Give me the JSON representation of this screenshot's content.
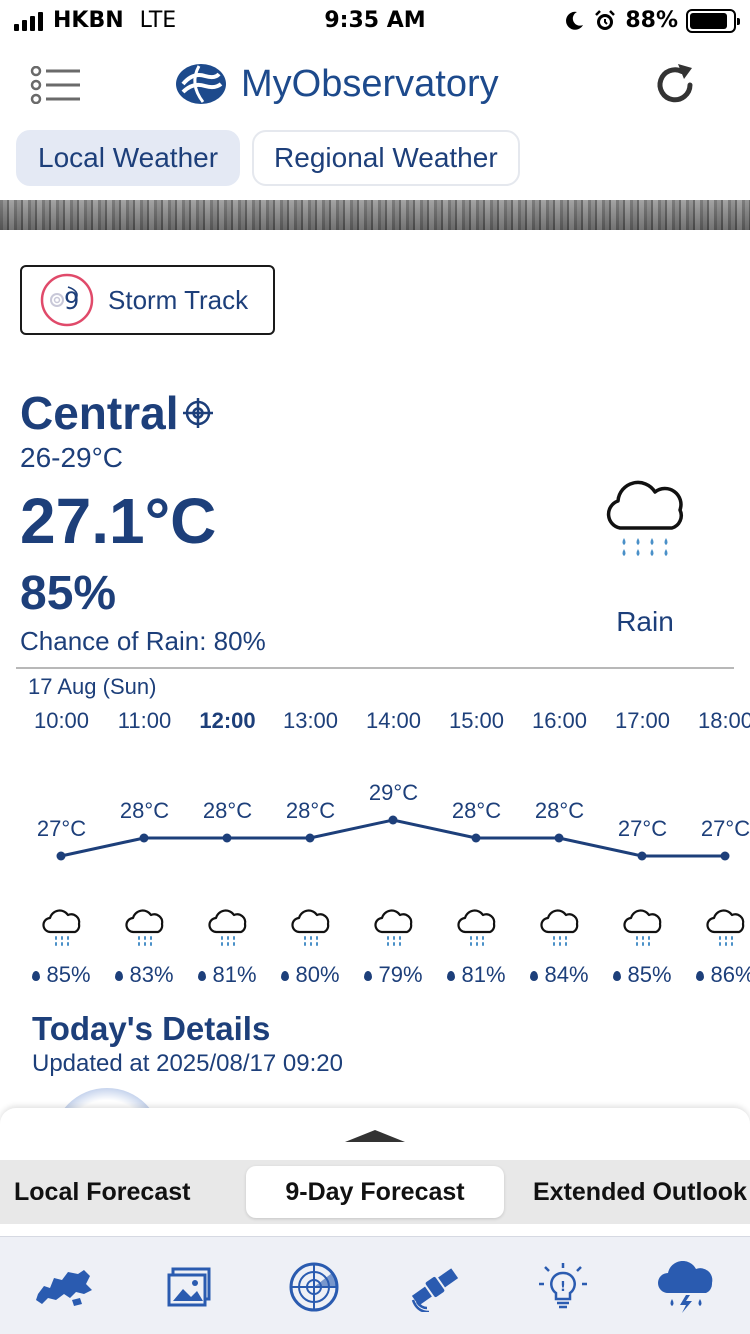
{
  "status_bar": {
    "carrier": "HKBN",
    "network": "LTE",
    "time": "9:35 AM",
    "battery": "88%",
    "battery_level": 0.88
  },
  "app": {
    "title": "MyObservatory",
    "brand_color": "#1d4a8c"
  },
  "tabs": [
    {
      "label": "Local Weather",
      "active": true
    },
    {
      "label": "Regional Weather",
      "active": false
    }
  ],
  "storm_track": {
    "label": "Storm Track",
    "icon": "typhoon-signal-icon"
  },
  "current": {
    "station": "Central",
    "range": "26-29°C",
    "temperature": "27.1°C",
    "humidity": "85%",
    "rain_chance": "Chance of Rain: 80%",
    "condition": "Rain",
    "condition_icon": "rain-cloud-icon"
  },
  "hourly": {
    "date": "17 Aug (Sun)",
    "items": [
      {
        "time": "10:00",
        "temp": "27°C",
        "temp_value": 27,
        "humidity": "85%",
        "bold": false
      },
      {
        "time": "11:00",
        "temp": "28°C",
        "temp_value": 28,
        "humidity": "83%",
        "bold": false
      },
      {
        "time": "12:00",
        "temp": "28°C",
        "temp_value": 28,
        "humidity": "81%",
        "bold": true
      },
      {
        "time": "13:00",
        "temp": "28°C",
        "temp_value": 28,
        "humidity": "80%",
        "bold": false
      },
      {
        "time": "14:00",
        "temp": "29°C",
        "temp_value": 29,
        "humidity": "79%",
        "bold": false
      },
      {
        "time": "15:00",
        "temp": "28°C",
        "temp_value": 28,
        "humidity": "81%",
        "bold": false
      },
      {
        "time": "16:00",
        "temp": "28°C",
        "temp_value": 28,
        "humidity": "84%",
        "bold": false
      },
      {
        "time": "17:00",
        "temp": "27°C",
        "temp_value": 27,
        "humidity": "85%",
        "bold": false
      },
      {
        "time": "18:00",
        "temp": "27°C",
        "temp_value": 27,
        "humidity": "86%",
        "bold": false
      }
    ]
  },
  "details": {
    "title": "Today's Details",
    "updated": "Updated at 2025/08/17 09:20"
  },
  "forecast_tabs": [
    {
      "label": "Local Forecast",
      "active": false
    },
    {
      "label": "9-Day Forecast",
      "active": true
    },
    {
      "label": "Extended Outlook",
      "active": false
    }
  ],
  "bottom_nav": [
    {
      "icon": "hong-kong-map-icon"
    },
    {
      "icon": "image-gallery-icon"
    },
    {
      "icon": "radar-icon"
    },
    {
      "icon": "satellite-icon"
    },
    {
      "icon": "uv-index-icon"
    },
    {
      "icon": "thunderstorm-warning-icon"
    }
  ]
}
